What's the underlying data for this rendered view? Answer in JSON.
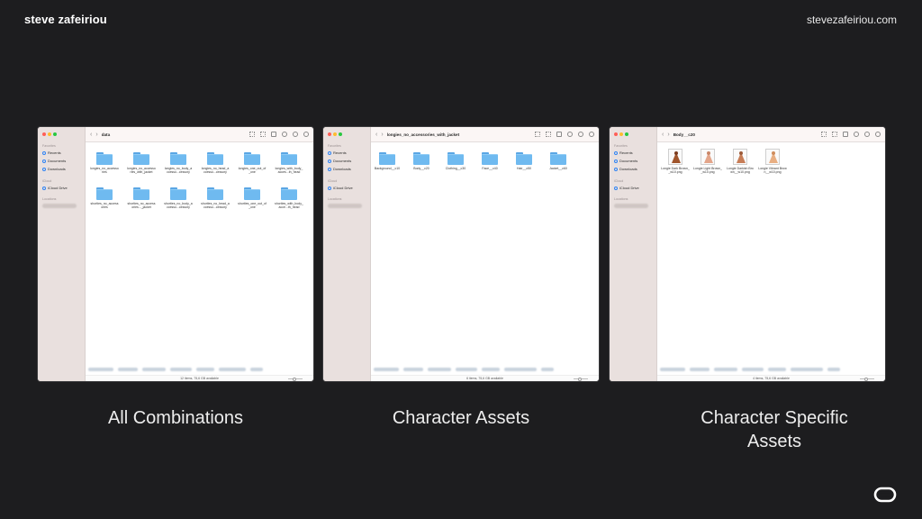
{
  "header": {
    "brand": "steve zafeiriou",
    "site": "stevezafeiriou.com"
  },
  "sidebar": {
    "favorites": "Favorites",
    "recents": "Recents",
    "documents": "Documents",
    "downloads": "Downloads",
    "icloud": "iCloud",
    "icloud_drive": "iCloud Drive",
    "locations": "Locations"
  },
  "windows": [
    {
      "title": "data",
      "items": [
        "longies_no_accessories",
        "longies_no_accessories_with_jacket",
        "longies_no_body_accesso...cessory",
        "longies_no_head_accesso...cessory",
        "longies_one_out_of_one",
        "longies_with_body_acces...th_head",
        "shorties_no_accessories",
        "shorties_no_accessories..._jacket",
        "shorties_no_body_accesso...cessory",
        "shorties_no_head_accesso...cessory",
        "shorties_one_out_of_one",
        "shorties_with_body_acce...th_head"
      ],
      "status": "12 items, 75,6 GB available",
      "caption": "All Combinations"
    },
    {
      "title": "longies_no_accessories_with_jacket",
      "items": [
        "Background__c10",
        "Body__c20",
        "Clothing__c30",
        "Face__c40",
        "Hair__c50",
        "Jacket__c60"
      ],
      "status": "6 items, 75,6 GB available",
      "caption": "Character Assets"
    },
    {
      "title": "Body__c20",
      "items": [
        "Longie Dark Brown__w10.png",
        "Longie Light Brown__w10.png",
        "Longie Darkish Brown__w10.png",
        "Longie Vibrant Brown__w10.png"
      ],
      "status": "4 items, 75,6 GB available",
      "caption": "Character Specific Assets"
    }
  ],
  "colors": {
    "background": "#1d1d1f",
    "folder": "#6fbaf0",
    "sidebar": "#e9e0de"
  },
  "icons": [
    "back-chevron-icon",
    "forward-chevron-icon",
    "grid-view-icon",
    "share-icon",
    "tag-icon",
    "more-icon",
    "search-icon",
    "folder-icon",
    "logo-icon"
  ]
}
